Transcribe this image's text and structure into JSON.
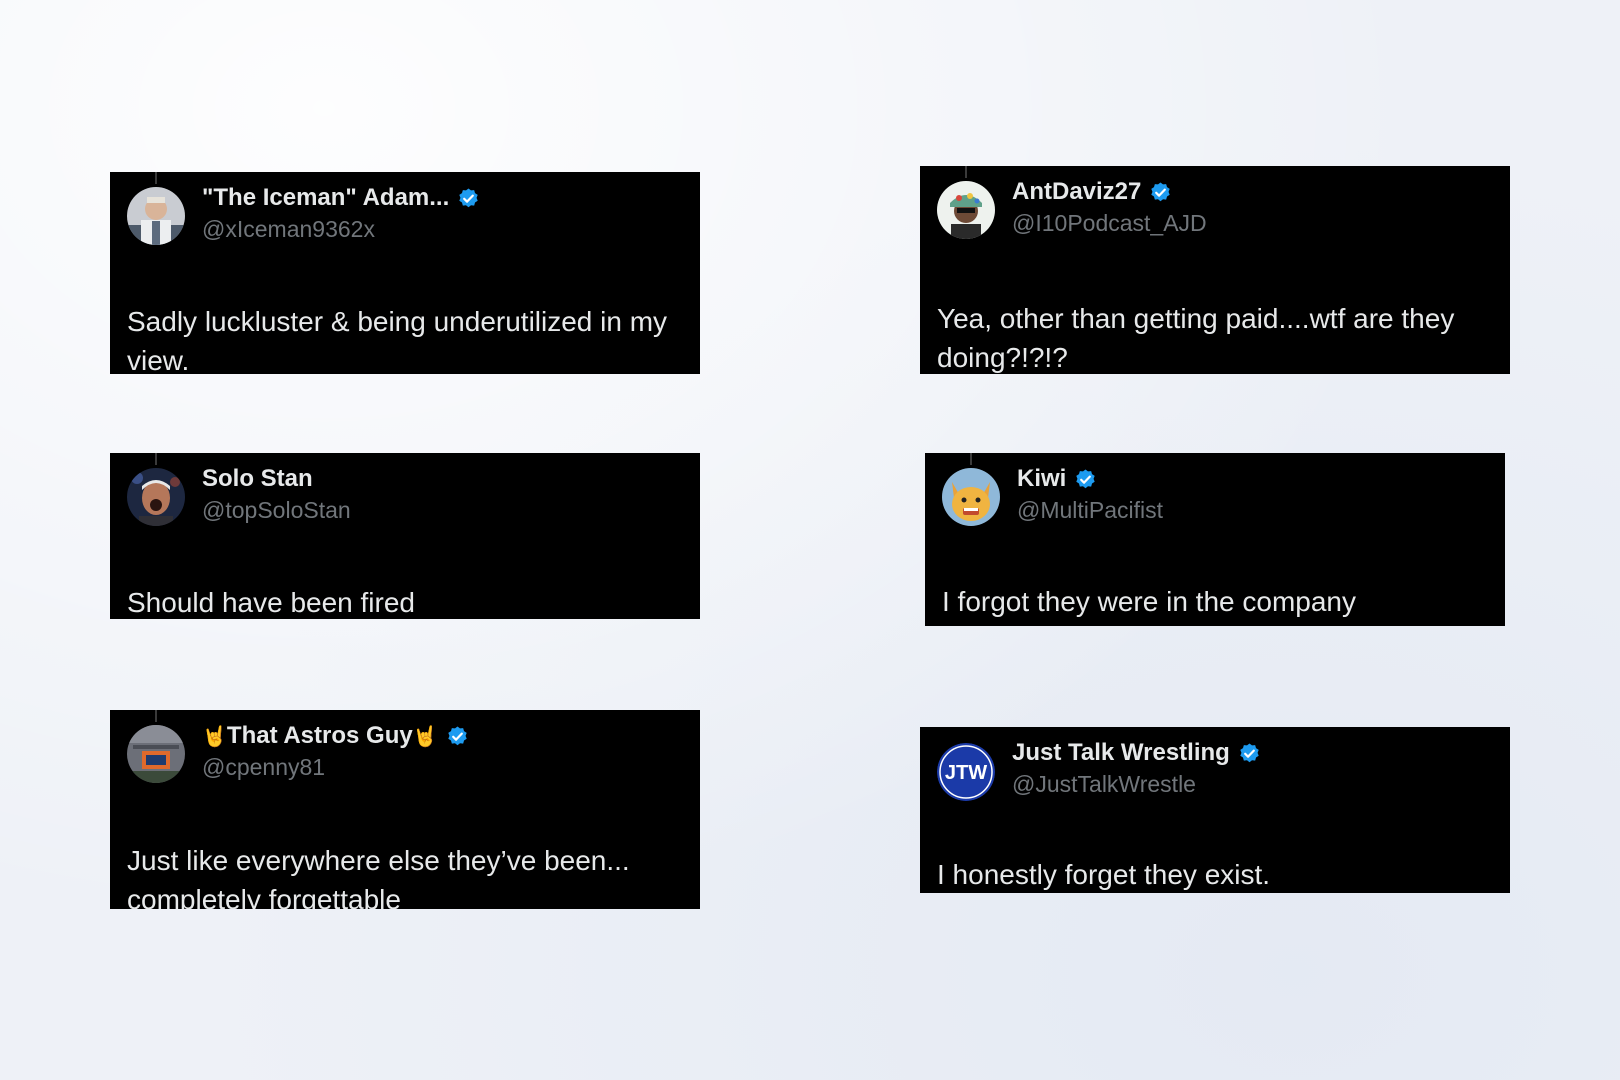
{
  "colors": {
    "page_background": "#eef1f7",
    "card_background": "#000000",
    "name_text": "#e7e9ea",
    "handle_text": "#71767b",
    "verified_badge": "#1d9bf0"
  },
  "tweets": [
    {
      "name": "\"The Iceman\" Adam...",
      "handle": "@xIceman9362x",
      "verified": true,
      "text": "Sadly luckluster & being underutilized in my view.",
      "avatar_icon": "person-photo-avatar"
    },
    {
      "name": "AntDaviz27",
      "handle": "@I10Podcast_AJD",
      "verified": true,
      "text": "Yea, other than getting paid....wtf are they doing?!?!?",
      "avatar_icon": "person-photo-avatar"
    },
    {
      "name": "Solo Stan",
      "handle": "@topSoloStan",
      "verified": false,
      "text": "Should have been fired",
      "avatar_icon": "wrestler-photo-avatar"
    },
    {
      "name": "Kiwi",
      "handle": "@MultiPacifist",
      "verified": true,
      "text": "I forgot they were in the company",
      "avatar_icon": "cartoon-character-avatar"
    },
    {
      "name": "That Astros Guy",
      "name_emoji": "🤘",
      "handle": "@cpenny81",
      "verified": true,
      "text": "Just like everywhere else they’ve been... completely forgettable",
      "avatar_icon": "stadium-photo-avatar"
    },
    {
      "name": "Just Talk Wrestling",
      "handle": "@JustTalkWrestle",
      "verified": true,
      "text": "I honestly forget they exist.",
      "avatar_icon": "jtw-logo-avatar",
      "avatar_logo_text": "JTW"
    }
  ]
}
